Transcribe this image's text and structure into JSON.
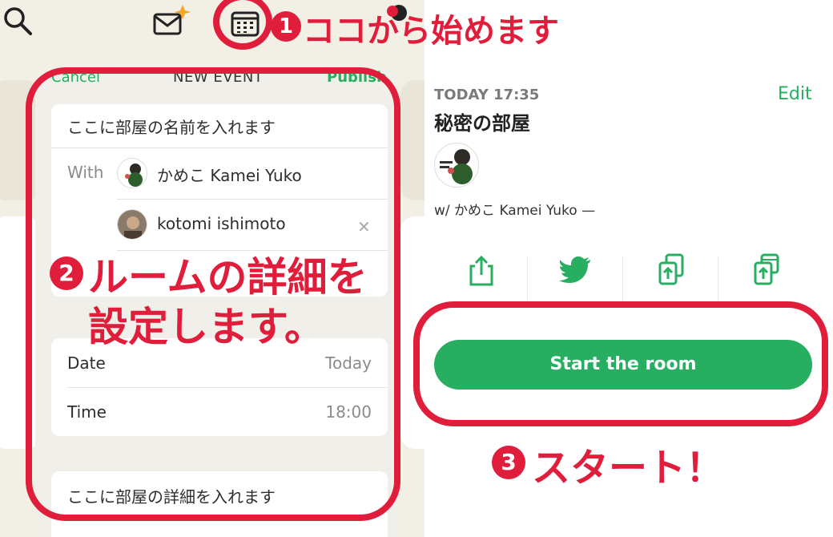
{
  "toolbar": {
    "icons": [
      "search-icon",
      "envelope-sparkle-icon",
      "calendar-icon",
      "bell-icon"
    ]
  },
  "event_sheet": {
    "cancel_label": "Cancel",
    "title": "NEW EVENT",
    "publish_label": "Publish",
    "room_name_placeholder": "ここに部屋の名前を入れます",
    "with_label": "With",
    "cohosts": [
      {
        "name": "かめこ Kamei Yuko"
      },
      {
        "name": "kotomi ishimoto"
      }
    ],
    "date_label": "Date",
    "date_value": "Today",
    "time_label": "Time",
    "time_value": "18:00",
    "description_placeholder": "ここに部屋の詳細を入れます"
  },
  "event_detail": {
    "datetime": "TODAY 17:35",
    "edit_label": "Edit",
    "room_title": "秘密の部屋",
    "host_line": "w/ かめこ Kamei Yuko —",
    "share_actions": [
      "share-icon",
      "twitter-icon",
      "copy-link-icon",
      "add-to-cal-icon"
    ],
    "start_button_label": "Start the room"
  },
  "annotations": {
    "step1": {
      "number": "1",
      "text": "ココから始めます"
    },
    "step2": {
      "number": "2",
      "line1": "ルームの詳細を",
      "line2": "設定します。"
    },
    "step3": {
      "number": "3",
      "text": "スタート！"
    }
  },
  "colors": {
    "brand_green": "#27ae60",
    "annotation_red": "#e01e3c",
    "sheet_bg": "#f1efe9",
    "app_bg": "#f2efe4"
  }
}
